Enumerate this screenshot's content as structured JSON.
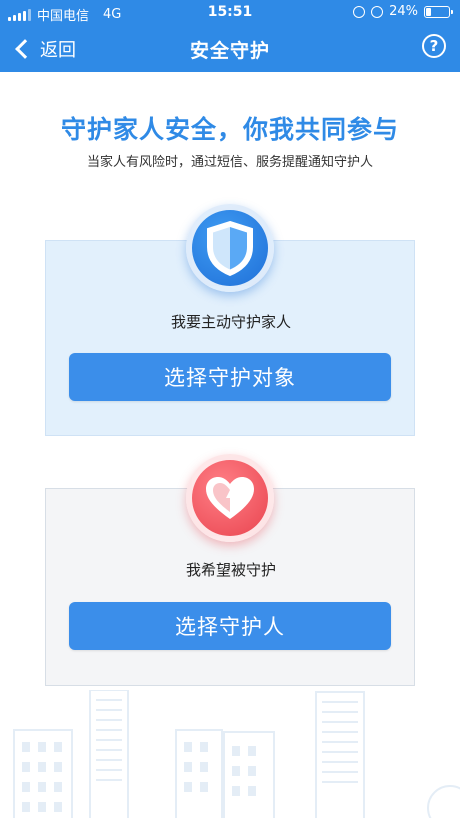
{
  "status_bar": {
    "carrier": "中国电信",
    "network": "4G",
    "time": "15:51",
    "battery_percent": "24%",
    "battery_level": 0.24
  },
  "navbar": {
    "back_label": "返回",
    "title": "安全守护",
    "help_glyph": "?"
  },
  "hero": {
    "title": "守护家人安全，你我共同参与",
    "subtitle": "当家人有风险时，通过短信、服务提醒通知守护人"
  },
  "guard_card": {
    "icon": "shield-icon",
    "label": "我要主动守护家人",
    "button_label": "选择守护对象"
  },
  "guarded_card": {
    "icon": "heart-icon",
    "label": "我希望被守护",
    "button_label": "选择守护人"
  },
  "colors": {
    "primary": "#2f8ae6",
    "button": "#3b8eea",
    "heart": "#e9444f"
  }
}
